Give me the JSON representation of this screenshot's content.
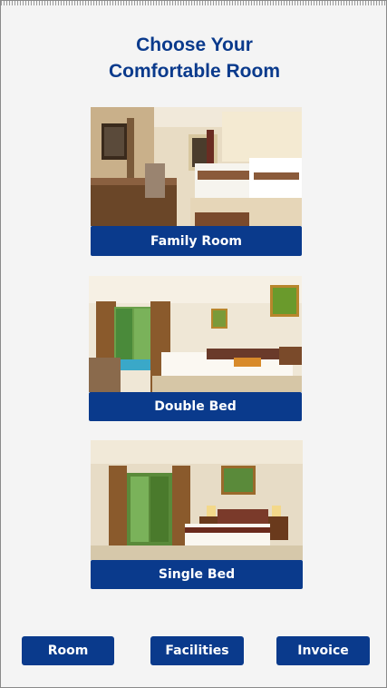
{
  "header": {
    "title_line1": "Choose Your",
    "title_line2": "Comfortable Room"
  },
  "rooms": [
    {
      "label": "Family Room"
    },
    {
      "label": "Double Bed"
    },
    {
      "label": "Single Bed"
    }
  ],
  "nav": {
    "room": "Room",
    "facilities": "Facilities",
    "invoice": "Invoice"
  },
  "colors": {
    "accent": "#0a3a8c",
    "background": "#f4f4f4"
  }
}
